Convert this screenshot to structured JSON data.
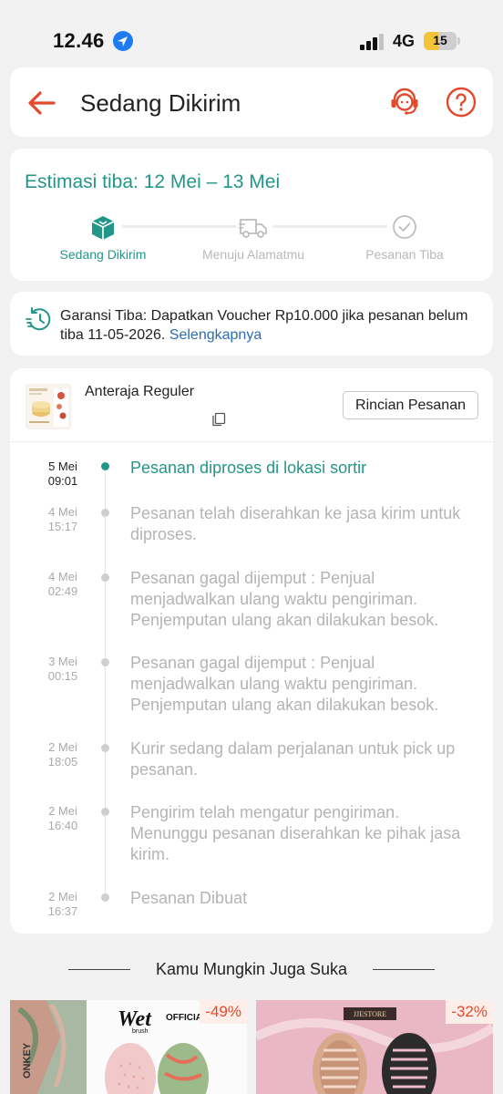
{
  "status_bar": {
    "time": "12.46",
    "network": "4G",
    "battery": "15",
    "battery_level": 0.15
  },
  "header": {
    "title": "Sedang Dikirim",
    "icons": [
      "back-arrow-icon",
      "support-agent-icon",
      "help-icon"
    ]
  },
  "estimate": {
    "text": "Estimasi tiba: 12 Mei – 13 Mei",
    "steps": [
      {
        "label": "Sedang Dikirim",
        "icon": "package-icon",
        "state": "active"
      },
      {
        "label": "Menuju Alamatmu",
        "icon": "truck-icon",
        "state": "inactive"
      },
      {
        "label": "Pesanan Tiba",
        "icon": "check-circle-icon",
        "state": "inactive"
      }
    ]
  },
  "guarantee": {
    "text": "Garansi Tiba: Dapatkan Voucher Rp10.000 jika pesanan belum tiba 11-05-2026.",
    "link": "Selengkapnya"
  },
  "shipment": {
    "courier": "Anteraja Reguler",
    "detail_button": "Rincian Pesanan"
  },
  "timeline": [
    {
      "date": "5 Mei",
      "time": "09:01",
      "text": "Pesanan diproses di lokasi sortir",
      "active": true
    },
    {
      "date": "4 Mei",
      "time": "15:17",
      "text": "Pesanan telah diserahkan ke jasa kirim untuk diproses.",
      "active": false
    },
    {
      "date": "4 Mei",
      "time": "02:49",
      "text": "Pesanan gagal dijemput : Penjual menjadwalkan ulang waktu pengiriman. Penjemputan ulang akan dilakukan besok.",
      "active": false
    },
    {
      "date": "3 Mei",
      "time": "00:15",
      "text": "Pesanan gagal dijemput : Penjual menjadwalkan ulang waktu pengiriman. Penjemputan ulang akan dilakukan besok.",
      "active": false
    },
    {
      "date": "2 Mei",
      "time": "18:05",
      "text": "Kurir sedang dalam perjalanan untuk pick up pesanan.",
      "active": false
    },
    {
      "date": "2 Mei",
      "time": "16:40",
      "text": "Pengirim telah mengatur pengiriman. Menunggu pesanan diserahkan ke pihak jasa kirim.",
      "active": false
    },
    {
      "date": "2 Mei",
      "time": "16:37",
      "text": "Pesanan Dibuat",
      "active": false
    }
  ],
  "recommendations": {
    "title": "Kamu Mungkin Juga Suka",
    "products": [
      {
        "discount": "-49%",
        "brand": "Wet",
        "brand_sub": "brush",
        "store_badge": "OFFICIAL STORE",
        "side_text": "ONKEY"
      },
      {
        "discount": "-32%",
        "brand": "JJESTORE"
      }
    ]
  },
  "colors": {
    "accent": "#23968a",
    "brand_orange": "#e4492c",
    "link": "#2e6db4"
  }
}
